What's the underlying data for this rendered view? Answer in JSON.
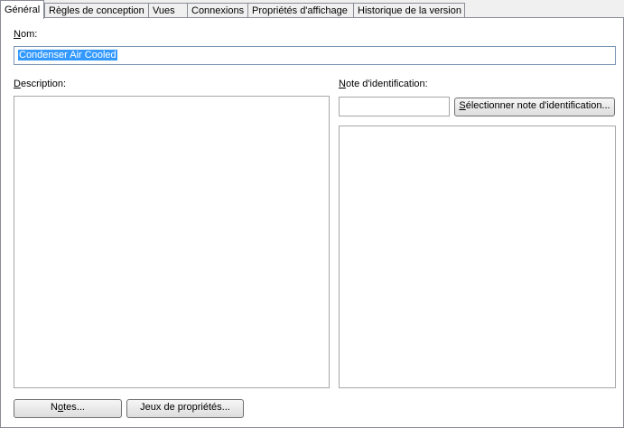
{
  "tabs": [
    {
      "label": "Général",
      "active": true
    },
    {
      "label": "Règles de conception",
      "active": false
    },
    {
      "label": "Vues",
      "active": false
    },
    {
      "label": "Connexions",
      "active": false
    },
    {
      "label": "Propriétés d'affichage",
      "active": false
    },
    {
      "label": "Historique de la version",
      "active": false
    }
  ],
  "general": {
    "name_label_first": "N",
    "name_label_rest": "om:",
    "name_value": "Condenser Air Cooled",
    "description_label_first": "D",
    "description_label_rest": "escription:",
    "id_note_label_first": "N",
    "id_note_label_rest": "ote d'identification:",
    "id_note_value": "",
    "select_note_button_first": "S",
    "select_note_button_rest": "électionner note d'identification...",
    "notes_button_pre": "N",
    "notes_button_u": "o",
    "notes_button_post": "tes...",
    "property_sets_button": "Jeux de propriétés..."
  }
}
